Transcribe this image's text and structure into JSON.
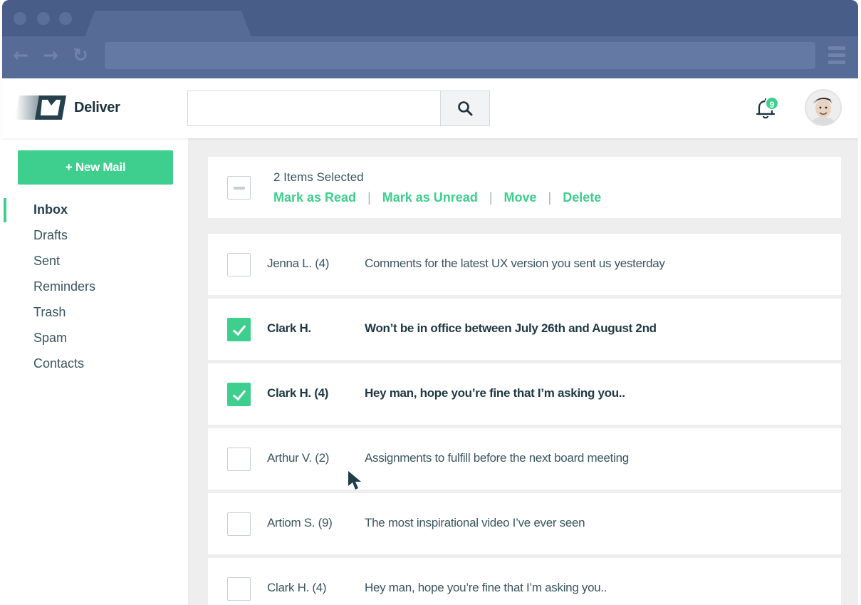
{
  "app": {
    "brand": "Deliver"
  },
  "search": {
    "placeholder": "",
    "value": ""
  },
  "notifications": {
    "count": "9"
  },
  "sidebar": {
    "new_mail_label": "+ New Mail",
    "items": [
      {
        "label": "Inbox",
        "active": true
      },
      {
        "label": "Drafts"
      },
      {
        "label": "Sent"
      },
      {
        "label": "Reminders"
      },
      {
        "label": "Trash"
      },
      {
        "label": "Spam"
      },
      {
        "label": "Contacts"
      }
    ]
  },
  "selection": {
    "summary": "2 Items Selected",
    "actions": [
      "Mark as Read",
      "Mark as Unread",
      "Move",
      "Delete"
    ],
    "separator": "|"
  },
  "emails": [
    {
      "sender": "Jenna L. (4)",
      "subject": "Comments for the latest UX version you sent us yesterday",
      "checked": false
    },
    {
      "sender": "Clark H.",
      "subject": "Won’t be in office between July 26th and August 2nd",
      "checked": true
    },
    {
      "sender": "Clark H. (4)",
      "subject": "Hey man, hope you’re fine that I’m asking you..",
      "checked": true
    },
    {
      "sender": "Arthur V. (2)",
      "subject": "Assignments to fulfill before the next board meeting",
      "checked": false
    },
    {
      "sender": "Artiom S. (9)",
      "subject": "The most inspirational video I’ve ever seen",
      "checked": false
    },
    {
      "sender": "Clark H. (4)",
      "subject": "Hey man, hope you’re fine that I’m asking you..",
      "checked": false
    }
  ],
  "colors": {
    "accent": "#3ecf8e",
    "chrome": "#4a5f8a",
    "text": "#3b5560",
    "background": "#eeeeee"
  },
  "icons": {
    "back": "arrow-left-icon",
    "forward": "arrow-right-icon",
    "reload": "reload-icon",
    "menu": "hamburger-menu-icon",
    "search": "search-icon",
    "notifications": "bell-icon"
  }
}
